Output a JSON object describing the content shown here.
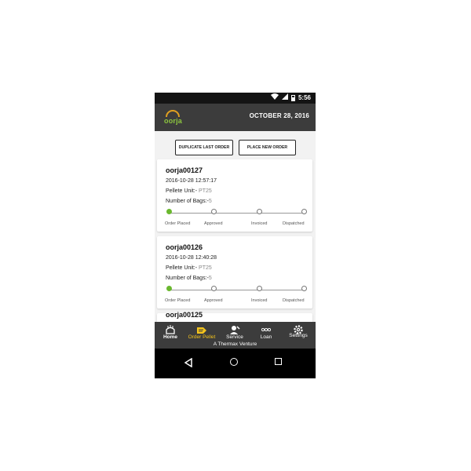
{
  "status_bar": {
    "time": "5:56"
  },
  "header": {
    "logo_text": "oorja",
    "date": "OCTOBER 28, 2016"
  },
  "actions": {
    "duplicate_label": "DUPLICATE LAST ORDER",
    "new_order_label": "PLACE NEW ORDER"
  },
  "orders": [
    {
      "id": "oorja00127",
      "timestamp": "2016-10-28 12:57:17",
      "unit_label": "Pellete Unit:-",
      "unit_value": "PT25",
      "bags_label": "Number of Bags:-",
      "bags_value": "5",
      "stages": [
        "Order Placed",
        "Approved",
        "Invoiced",
        "Dispatched"
      ]
    },
    {
      "id": "oorja00126",
      "timestamp": "2016-10-28 12:40:28",
      "unit_label": "Pellete Unit:-",
      "unit_value": "PT25",
      "bags_label": "Number of Bags:-",
      "bags_value": "5",
      "stages": [
        "Order Placed",
        "Approved",
        "Invoiced",
        "Dispatched"
      ]
    },
    {
      "id": "oorja00125"
    }
  ],
  "bottom_nav": {
    "items": [
      {
        "label": "Home",
        "icon": "home-icon"
      },
      {
        "label": "Order Pellet",
        "icon": "order-pellet-icon"
      },
      {
        "label": "Service",
        "icon": "service-icon"
      },
      {
        "label": "Loan",
        "icon": "loan-icon"
      },
      {
        "label": "Settings",
        "icon": "gear-icon"
      }
    ],
    "active_index": 1,
    "footer": "A Thermax Venture"
  },
  "colors": {
    "accent_green": "#6ab82e",
    "nav_active": "#f3c31c",
    "bar_bg": "#3c3c3c"
  }
}
